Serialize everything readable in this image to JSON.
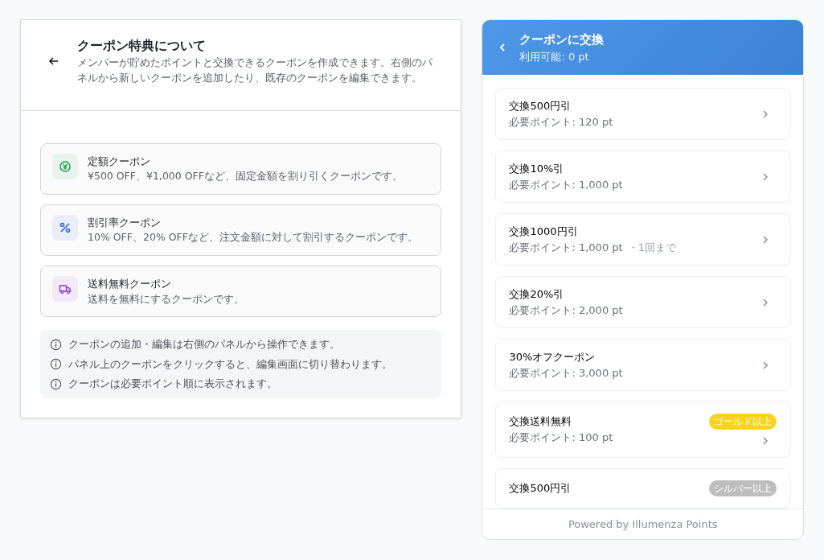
{
  "info_panel": {
    "title": "クーポン特典について",
    "description": "メンバーが貯めたポイントと交換できるクーポンを作成できます。右側のパネルから新しいクーポンを追加したり、既存のクーポンを編集できます。",
    "coupon_types": [
      {
        "kind": "fixed",
        "title": "定額クーポン",
        "description": "¥500 OFF、¥1,000 OFFなど、固定金額を割り引くクーポンです。",
        "color": "#16a34a"
      },
      {
        "kind": "percent",
        "title": "割引率クーポン",
        "description": "10% OFF、20% OFFなど、注文金額に対して割引するクーポンです。",
        "color": "#2563eb"
      },
      {
        "kind": "shipping",
        "title": "送料無料クーポン",
        "description": "送料を無料にするクーポンです。",
        "color": "#9333ea"
      }
    ],
    "notes": [
      "クーポンの追加・編集は右側のパネルから操作できます。",
      "パネル上のクーポンをクリックすると、編集画面に切り替わります。",
      "クーポンは必要ポイント順に表示されます。"
    ]
  },
  "exchange_panel": {
    "title": "クーポンに交換",
    "available": "利用可能: 0 pt",
    "coupons": [
      {
        "name": "交換500円引",
        "points": "必要ポイント: 120 pt"
      },
      {
        "name": "交換10%引",
        "points": "必要ポイント: 1,000 pt"
      },
      {
        "name": "交換1000円引",
        "points": "必要ポイント: 1,000 pt",
        "limit": "・1回まで"
      },
      {
        "name": "交換20%引",
        "points": "必要ポイント: 2,000 pt"
      },
      {
        "name": "30%オフクーポン",
        "points": "必要ポイント: 3,000 pt"
      },
      {
        "name": "交換送料無料",
        "points": "必要ポイント: 100 pt",
        "tier": {
          "label": "ゴールド以上",
          "color": "#fbd31b"
        }
      },
      {
        "name": "交換500円引",
        "tier": {
          "label": "シルバー以上",
          "color": "#bdbdbd"
        }
      }
    ],
    "footer": "Powered by Illumenza Points"
  }
}
